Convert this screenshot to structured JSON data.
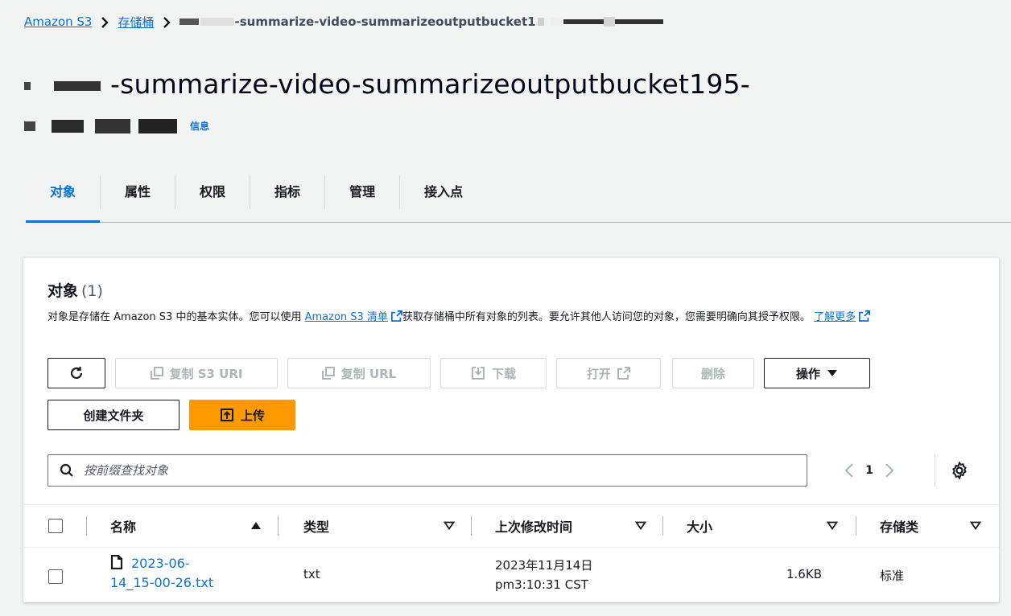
{
  "breadcrumb": {
    "root": "Amazon S3",
    "buckets": "存储桶",
    "current": "-summarize-video-summarizeoutputbucket1"
  },
  "title": {
    "text": "-summarize-video-summarizeoutputbucket195-",
    "info": "信息"
  },
  "tabs": [
    {
      "label": "对象",
      "active": true
    },
    {
      "label": "属性"
    },
    {
      "label": "权限"
    },
    {
      "label": "指标"
    },
    {
      "label": "管理"
    },
    {
      "label": "接入点"
    }
  ],
  "objects_panel": {
    "title": "对象",
    "count": "(1)",
    "desc_part1": "对象是存储在 Amazon S3 中的基本实体。您可以使用 ",
    "inventory_link": "Amazon S3 清单",
    "desc_part2": "获取存储桶中所有对象的列表。要允许其他人访问您的对象，您需要明确向其授予权限。",
    "learn_more": "了解更多"
  },
  "toolbar": {
    "copy_s3_uri": "复制 S3 URI",
    "copy_url": "复制 URL",
    "download": "下载",
    "open": "打开",
    "delete": "删除",
    "actions": "操作",
    "create_folder": "创建文件夹",
    "upload": "上传"
  },
  "search": {
    "placeholder": "按前缀查找对象"
  },
  "pagination": {
    "page": "1"
  },
  "table": {
    "columns": [
      "名称",
      "类型",
      "上次修改时间",
      "大小",
      "存储类"
    ],
    "rows": [
      {
        "name_line1": "2023-06-",
        "name_line2": "14_15-00-26.txt",
        "type": "txt",
        "modified_line1": "2023年11月14日",
        "modified_line2": "pm3:10:31 CST",
        "size": "1.6KB",
        "storage_class": "标准"
      }
    ]
  },
  "colors": {
    "link": "#0972d3",
    "primary": "#ff9900",
    "text": "#16191f",
    "disabled": "#aab7b8"
  }
}
